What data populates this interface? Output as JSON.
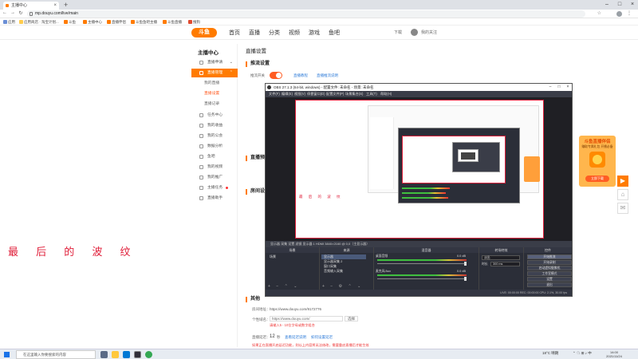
{
  "browser": {
    "tab_title": "主播中心",
    "url": "mp.douyu.com/live/main",
    "bookmarks": [
      "应用",
      "应用商店 · 淘宝计划...",
      "斗鱼",
      "主播中心",
      "直播伴侣",
      "斗鱼鱼吧主播",
      "斗鱼直播",
      "搜狗"
    ]
  },
  "site": {
    "logo": "斗鱼",
    "nav": [
      "首页",
      "直播",
      "分类",
      "视频",
      "游戏",
      "鱼吧"
    ],
    "header_right": [
      "下载",
      "开播",
      "我的关注"
    ]
  },
  "sidebar": {
    "title": "主播中心",
    "items": [
      {
        "label": "直播申请"
      },
      {
        "label": "直播管理",
        "active": true
      },
      {
        "sub": "我的直播"
      },
      {
        "sub": "直播设置",
        "active": true
      },
      {
        "sub": "直播记录"
      },
      {
        "label": "任务中心"
      },
      {
        "label": "我的收益"
      },
      {
        "label": "我的公会"
      },
      {
        "label": "数据分析"
      },
      {
        "label": "鱼吧"
      },
      {
        "label": "我的视频"
      },
      {
        "label": "我的推广"
      },
      {
        "label": "主播任务"
      },
      {
        "label": "直播助手"
      }
    ]
  },
  "main": {
    "title": "直播设置",
    "section_push": "推流设置",
    "toggle_label": "推流开关",
    "links": [
      "直播教程",
      "直播推流说明"
    ],
    "section_preview": "直播预览",
    "section_room": "房间设置",
    "section_other": "其他",
    "room_url_label": "房间地址：",
    "room_url_value": "https://www.douyu.com/9172776",
    "custom_url_label": "个性域名：",
    "custom_url_placeholder": "https://www.douyu.com/",
    "custom_url_select": "选择",
    "custom_url_note": "请输入5 - 10位字母或数字组合",
    "delay_label": "直播延迟：",
    "delay_value": "12",
    "delay_unit": "秒",
    "delay_links": [
      "查看延迟说明",
      "如何设置延迟"
    ],
    "bottom_note": "如果正在直播开启延迟功能，则以上内容将无法修改，需要重启直播后才能生效"
  },
  "obs": {
    "title": "OBS 27.1.3 (64-bit, windows) - 配置文件: 未命名 - 场景: 未命名",
    "menus": [
      "文件(F)",
      "编辑(E)",
      "视图(V)",
      "停靠窗口(D)",
      "配置文件(P)",
      "场景集合(S)",
      "工具(T)",
      "帮助(H)"
    ],
    "canvas_text": "最 后 的 波 纹",
    "scene_info": "显示器 采集   设置   滤镜   显示器 1 HDMI 3840×2160 @ 0,0（主显示器）",
    "docks": {
      "scenes": {
        "title": "场景",
        "rows": [
          "场景"
        ]
      },
      "sources": {
        "title": "来源",
        "rows": [
          "显示器",
          "显示器采集 2",
          "窗口采集",
          "音频输入采集"
        ]
      },
      "mixer": {
        "title": "混音器",
        "rows": [
          "桌面音频",
          "麦克风/Aux"
        ],
        "levels": [
          "0.0 dB",
          "0.0 dB"
        ]
      },
      "transitions": {
        "title": "转场特效",
        "type": "淡出",
        "duration_label": "时长",
        "duration": "300 ms"
      },
      "controls": {
        "title": "控件",
        "buttons": [
          "开始推流",
          "开始录制",
          "启动虚拟摄像机",
          "工作室模式",
          "设置",
          "退出"
        ]
      }
    },
    "status": "LIVE: 00:00:00   REC: 00:00:00   CPU: 2.1%, 30.00 fps"
  },
  "overlay": {
    "text": "最 后 的 波 纹"
  },
  "right_ad": {
    "title": "斗鱼直播伴侣",
    "subtitle": "赚取专属礼包 开播必备",
    "button": "立即下载"
  },
  "taskbar": {
    "search_placeholder": "在这里输入你要搜索的内容",
    "weather": "18°C 晴朗",
    "time": "14:00",
    "date": "2021/11/24"
  },
  "colors": {
    "brand": "#ff7b00",
    "accent": "#ff5d23",
    "obs_bg": "#2b2e38",
    "canvas_border": "#e0203b"
  }
}
